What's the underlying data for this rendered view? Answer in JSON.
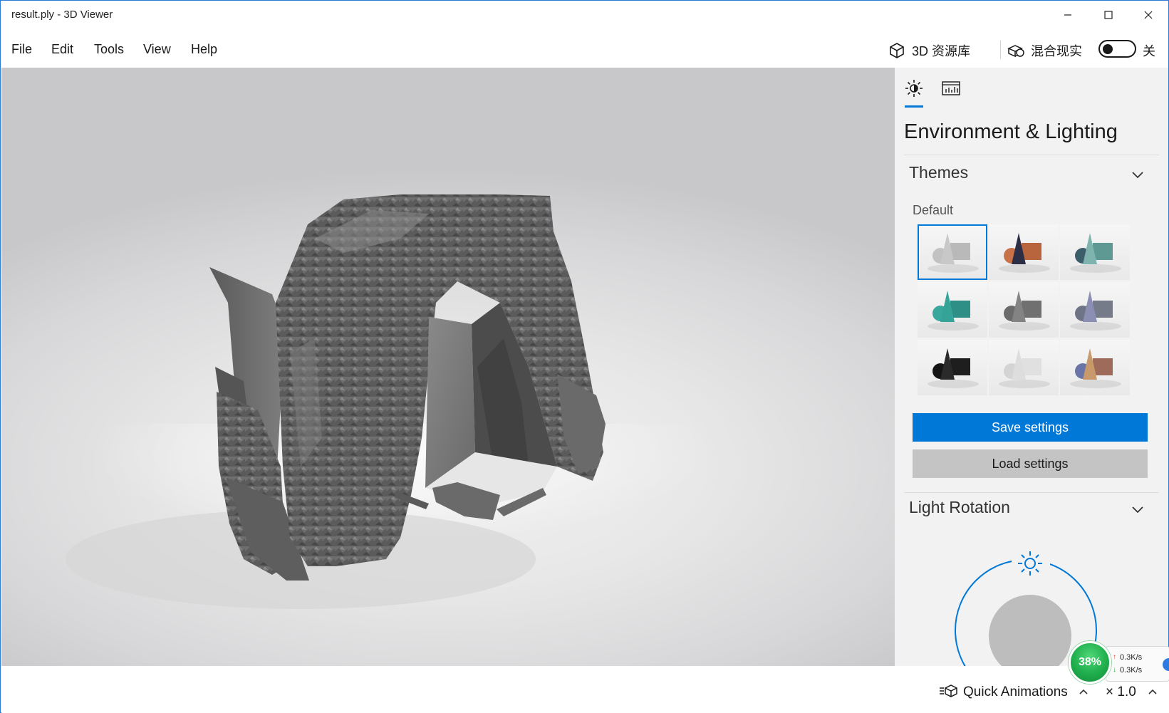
{
  "window": {
    "title": "result.ply - 3D Viewer"
  },
  "menu": {
    "items": [
      "File",
      "Edit",
      "Tools",
      "View",
      "Help"
    ]
  },
  "toolbar": {
    "library_label": "3D 资源库",
    "mixed_reality_label": "混合现实",
    "toggle_state_label": "关"
  },
  "panel": {
    "title": "Environment & Lighting",
    "themes": {
      "header": "Themes",
      "group_label": "Default",
      "selected_index": 0,
      "items": [
        {
          "shape_color": "#b9b9b9",
          "cone_color": "#c8c8c8",
          "sphere_color": "#c2c2c2"
        },
        {
          "shape_color": "#b8653d",
          "cone_color": "#2b2e44",
          "sphere_color": "#c9724a"
        },
        {
          "shape_color": "#5e9a93",
          "cone_color": "#7fb3ad",
          "sphere_color": "#3c5d6a"
        },
        {
          "shape_color": "#2e8f86",
          "cone_color": "#35a397",
          "sphere_color": "#3aa79c"
        },
        {
          "shape_color": "#707070",
          "cone_color": "#838383",
          "sphere_color": "#6b6b6b"
        },
        {
          "shape_color": "#767b8a",
          "cone_color": "#8b8fb3",
          "sphere_color": "#6f7386"
        },
        {
          "shape_color": "#1e1e1e",
          "cone_color": "#2a2a2a",
          "sphere_color": "#141414"
        },
        {
          "shape_color": "#e0e0e0",
          "cone_color": "#dddddd",
          "sphere_color": "#d4d4d4"
        },
        {
          "shape_color": "#9e6b5a",
          "cone_color": "#c89a6b",
          "sphere_color": "#6b74a6"
        }
      ]
    },
    "save_label": "Save settings",
    "load_label": "Load settings",
    "light_rotation": {
      "header": "Light Rotation"
    }
  },
  "bottom": {
    "quick_animations_label": "Quick Animations",
    "speed_label": "× 1.0"
  },
  "network": {
    "percent": "38%",
    "up_speed": "0.3K/s",
    "down_speed": "0.3K/s"
  },
  "colors": {
    "accent": "#0078d7",
    "panel_bg": "#f2f2f2",
    "model_gray": "#6e6e6e"
  }
}
